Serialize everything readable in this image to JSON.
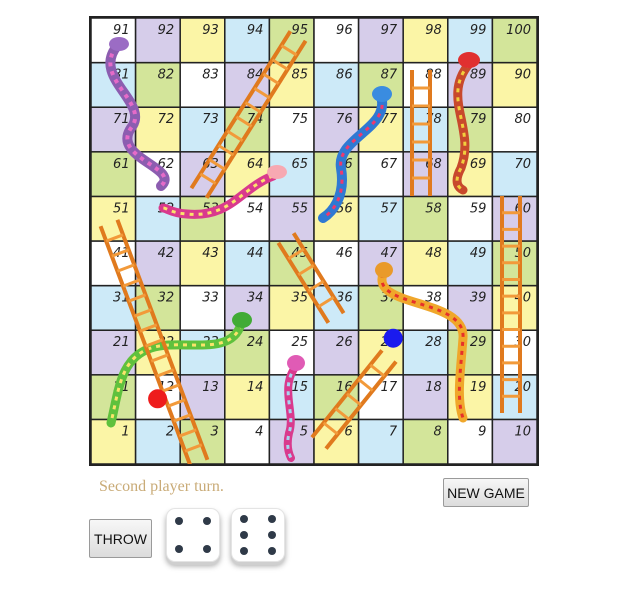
{
  "board": {
    "cells": [
      "1",
      "2",
      "3",
      "4",
      "5",
      "6",
      "7",
      "8",
      "9",
      "10",
      "11",
      "12",
      "13",
      "14",
      "15",
      "16",
      "17",
      "18",
      "19",
      "20",
      "21",
      "22",
      "23",
      "24",
      "25",
      "26",
      "27",
      "28",
      "29",
      "30",
      "31",
      "32",
      "33",
      "34",
      "35",
      "36",
      "37",
      "38",
      "39",
      "40",
      "41",
      "42",
      "43",
      "44",
      "45",
      "46",
      "47",
      "48",
      "49",
      "50",
      "51",
      "52",
      "53",
      "54",
      "55",
      "56",
      "57",
      "58",
      "59",
      "60",
      "61",
      "62",
      "63",
      "64",
      "65",
      "66",
      "67",
      "68",
      "69",
      "70",
      "71",
      "72",
      "73",
      "74",
      "75",
      "76",
      "77",
      "78",
      "79",
      "80",
      "81",
      "82",
      "83",
      "84",
      "85",
      "86",
      "87",
      "88",
      "89",
      "90",
      "91",
      "92",
      "93",
      "94",
      "95",
      "96",
      "97",
      "98",
      "99",
      "100"
    ],
    "palette": [
      "#fbf5a6",
      "#cdeaf8",
      "#d3e59a",
      "#ffffff",
      "#d6cdea"
    ],
    "players": [
      {
        "name": "player-1-token",
        "color": "#ee1c1c",
        "position": 12
      },
      {
        "name": "player-2-token",
        "color": "#1a1aee",
        "position": 28
      }
    ]
  },
  "status_text": "Second player turn.",
  "buttons": {
    "new_game": "NEW GAME",
    "throw": "THROW"
  },
  "dice": [
    4,
    6
  ]
}
